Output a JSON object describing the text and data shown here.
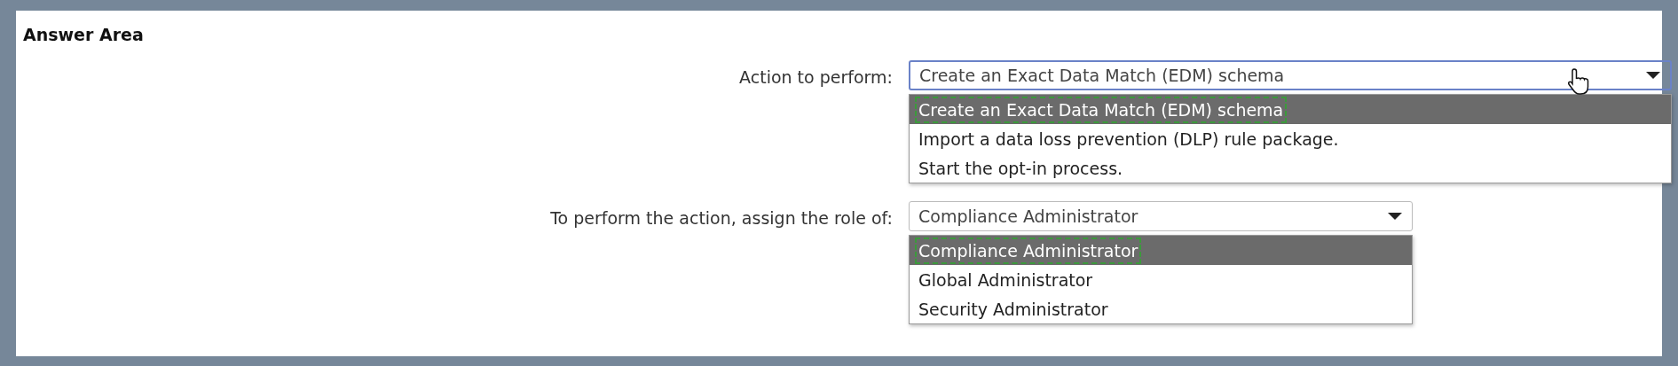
{
  "title": "Answer Area",
  "questions": [
    {
      "label": "Action to perform:",
      "value": "Create an Exact Data Match (EDM) schema",
      "hover": true,
      "options": [
        {
          "text": "Create an Exact Data Match (EDM) schema",
          "selected": true,
          "marked": true
        },
        {
          "text": "Import a data loss prevention (DLP) rule package.",
          "selected": false,
          "marked": false
        },
        {
          "text": "Start the opt-in process.",
          "selected": false,
          "marked": false
        }
      ]
    },
    {
      "label": "To perform the action, assign the role of:",
      "value": "Compliance Administrator",
      "hover": false,
      "options": [
        {
          "text": "Compliance Administrator",
          "selected": true,
          "marked": true
        },
        {
          "text": "Global Administrator",
          "selected": false,
          "marked": false
        },
        {
          "text": "Security Administrator",
          "selected": false,
          "marked": false
        }
      ]
    }
  ]
}
